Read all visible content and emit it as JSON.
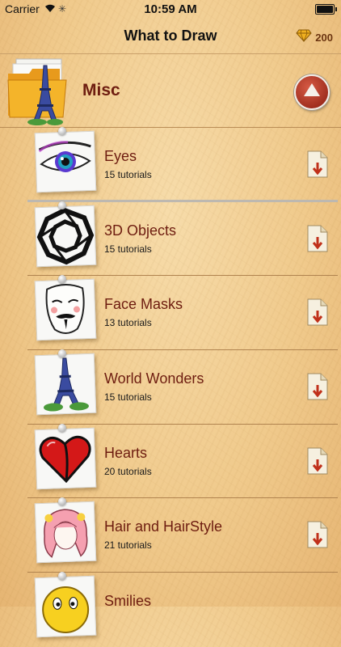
{
  "status_bar": {
    "carrier": "Carrier",
    "time": "10:59 AM"
  },
  "nav": {
    "title": "What to Draw",
    "gems": "200"
  },
  "category": {
    "title": "Misc",
    "folder_icon": "folder-eiffel-icon",
    "toggle_icon": "arrow-up-icon"
  },
  "colors": {
    "title_red": "#6e1d10",
    "accent_red": "#a82a17",
    "paper": "#f0ca8c"
  },
  "items": [
    {
      "title": "Eyes",
      "count": "15 tutorials",
      "icon": "eye-icon"
    },
    {
      "title": "3D Objects",
      "count": "15 tutorials",
      "icon": "3d-knot-icon"
    },
    {
      "title": "Face Masks",
      "count": "13 tutorials",
      "icon": "mask-icon"
    },
    {
      "title": "World Wonders",
      "count": "15 tutorials",
      "icon": "eiffel-tower-icon"
    },
    {
      "title": "Hearts",
      "count": "20 tutorials",
      "icon": "heart-icon"
    },
    {
      "title": "Hair and HairStyle",
      "count": "21 tutorials",
      "icon": "hair-icon"
    },
    {
      "title": "Smilies",
      "count": "",
      "icon": "smiley-icon"
    }
  ]
}
